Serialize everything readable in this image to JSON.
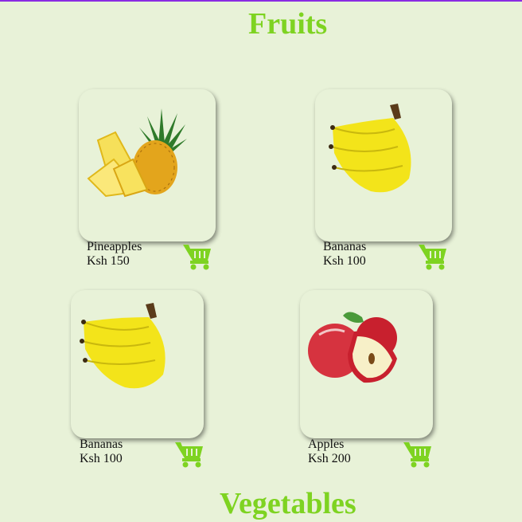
{
  "sections": {
    "fruits_title": "Fruits",
    "vegetables_title": "Vegetables"
  },
  "products": [
    {
      "name": "Pineapples",
      "price": "Ksh 150",
      "image": "pineapple"
    },
    {
      "name": "Bananas",
      "price": "Ksh 100",
      "image": "banana"
    },
    {
      "name": "Bananas",
      "price": "Ksh 100",
      "image": "banana"
    },
    {
      "name": "Apples",
      "price": "Ksh 200",
      "image": "apple"
    }
  ],
  "icons": {
    "cart": "shopping-cart-icon"
  },
  "colors": {
    "accent": "#7ed321",
    "background": "#e8f2d8",
    "banana": "#f3e41a"
  }
}
